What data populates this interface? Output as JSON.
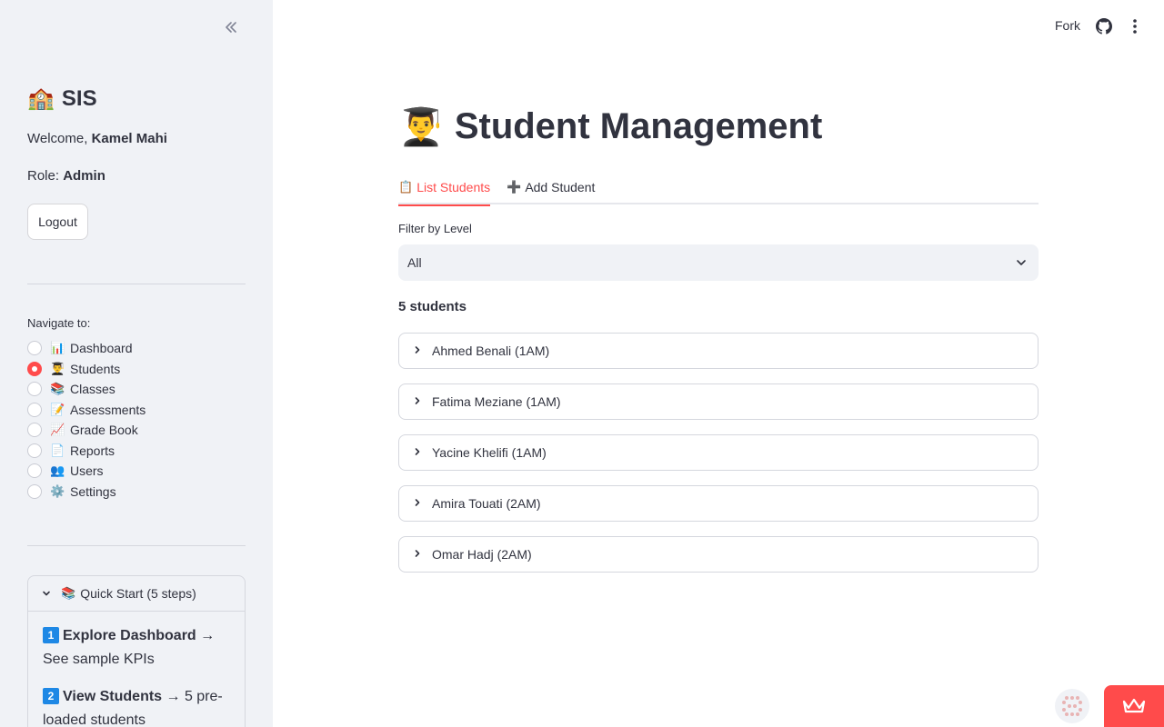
{
  "sidebar": {
    "app_emoji": "🏫",
    "app_title": "SIS",
    "welcome_prefix": "Welcome, ",
    "user_name": "Kamel Mahi",
    "role_prefix": "Role: ",
    "role": "Admin",
    "logout_label": "Logout",
    "nav_label": "Navigate to:",
    "nav_items": [
      {
        "emoji": "📊",
        "label": "Dashboard",
        "selected": false
      },
      {
        "emoji": "👨‍🎓",
        "label": "Students",
        "selected": true
      },
      {
        "emoji": "📚",
        "label": "Classes",
        "selected": false
      },
      {
        "emoji": "📝",
        "label": "Assessments",
        "selected": false
      },
      {
        "emoji": "📈",
        "label": "Grade Book",
        "selected": false
      },
      {
        "emoji": "📄",
        "label": "Reports",
        "selected": false
      },
      {
        "emoji": "👥",
        "label": "Users",
        "selected": false
      },
      {
        "emoji": "⚙️",
        "label": "Settings",
        "selected": false
      }
    ],
    "quickstart": {
      "emoji": "📚",
      "title": "Quick Start (5 steps)",
      "steps": [
        {
          "num": "1",
          "bold": "Explore Dashboard",
          "rest": " → See sample KPIs"
        },
        {
          "num": "2",
          "bold": "View Students",
          "rest": " → 5 pre-loaded students"
        }
      ]
    }
  },
  "header": {
    "fork_label": "Fork"
  },
  "main": {
    "title_emoji": "👨‍🎓",
    "title": "Student Management",
    "tabs": [
      {
        "emoji": "📋",
        "label": "List Students",
        "active": true
      },
      {
        "emoji": "➕",
        "label": "Add Student",
        "active": false
      }
    ],
    "filter_label": "Filter by Level",
    "filter_value": "All",
    "count_heading": "5 students",
    "students": [
      "Ahmed Benali (1AM)",
      "Fatima Meziane (1AM)",
      "Yacine Khelifi (1AM)",
      "Amira Touati (2AM)",
      "Omar Hadj (2AM)"
    ]
  },
  "colors": {
    "accent": "#ff4b4b",
    "sidebar_bg": "#f0f2f6",
    "text": "#31333f"
  }
}
